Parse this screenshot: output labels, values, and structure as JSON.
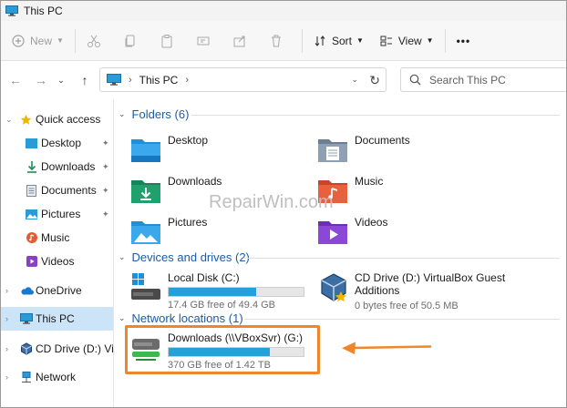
{
  "window": {
    "title": "This PC"
  },
  "toolbar": {
    "new_label": "New",
    "sort_label": "Sort",
    "view_label": "View",
    "more_label": "•••"
  },
  "address": {
    "crumb": "This PC",
    "search_placeholder": "Search This PC"
  },
  "nav": {
    "quick_access": "Quick access",
    "items": [
      {
        "label": "Desktop"
      },
      {
        "label": "Downloads"
      },
      {
        "label": "Documents"
      },
      {
        "label": "Pictures"
      },
      {
        "label": "Music"
      },
      {
        "label": "Videos"
      }
    ],
    "onedrive": "OneDrive",
    "this_pc": "This PC",
    "cd_drive": "CD Drive (D:) Virtual",
    "network": "Network"
  },
  "groups": {
    "folders": "Folders (6)",
    "devices": "Devices and drives (2)",
    "network": "Network locations (1)"
  },
  "folders": [
    {
      "label": "Desktop"
    },
    {
      "label": "Documents"
    },
    {
      "label": "Downloads"
    },
    {
      "label": "Music"
    },
    {
      "label": "Pictures"
    },
    {
      "label": "Videos"
    }
  ],
  "drives": {
    "local": {
      "name": "Local Disk (C:)",
      "free": "17.4 GB free of 49.4 GB",
      "used_fraction": 0.65
    },
    "cd": {
      "name_line1": "CD Drive (D:) VirtualBox Guest",
      "name_line2": "Additions",
      "free": "0 bytes free of 50.5 MB"
    },
    "network": {
      "name": "Downloads (\\\\VBoxSvr) (G:)",
      "free": "370 GB free of 1.42 TB",
      "used_fraction": 0.75
    }
  },
  "watermark": "RepairWin.com",
  "colors": {
    "accent": "#26a0da",
    "highlight": "#f0862a",
    "group_header": "#1a5ca8",
    "selection": "#cce4f7"
  }
}
